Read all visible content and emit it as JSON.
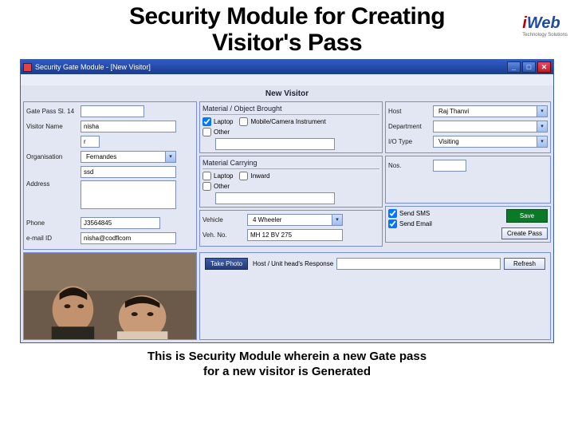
{
  "slide": {
    "title_line1": "Security Module for Creating",
    "title_line2": "Visitor's Pass",
    "caption_line1": "This is Security Module wherein a new Gate pass",
    "caption_line2": "for a new visitor is Generated",
    "logo_text": "Web",
    "logo_sub": "Technology Solutions"
  },
  "window": {
    "title": "Security Gate Module - [New Visitor]",
    "section_title": "New Visitor"
  },
  "left": {
    "gatepass_label": "Gate Pass Sl.  14",
    "gatepass_value": "",
    "visitor_name_label": "Visitor Name",
    "visitor_name_value": "nisha",
    "initial_label": "",
    "initial_value": "r",
    "organisation_label": "Organisation",
    "organisation_value": "Fernandes",
    "org_sub_value": "ssd",
    "address_label": "Address",
    "address_value": "",
    "phone_label": "Phone",
    "phone_value": "J3564845",
    "email_label": "e-mail ID",
    "email_value": "nisha@codflcom"
  },
  "mid_top": {
    "group_title": "Material / Object Brought",
    "laptop_label": "Laptop",
    "mobile_label": "Mobile/Camera Instrument",
    "other_label": "Other",
    "other_value": ""
  },
  "mid_bottom": {
    "group_title": "Material Carrying",
    "laptop_label": "Laptop",
    "other_label": "Other",
    "other_value": "",
    "inward_label": "Inward"
  },
  "mid_vehicle": {
    "vehicle_label": "Vehicle",
    "vehicle_value": "4 Wheeler",
    "vehno_label": "Veh. No.",
    "vehno_value": "MH 12 BV 275"
  },
  "right": {
    "host_label": "Host",
    "host_value": "Raj Thanvi",
    "dept_label": "Department",
    "dept_value": "",
    "iotype_label": "I/O Type",
    "iotype_value": "Visiting",
    "sendsms_label": "Send SMS",
    "sendemail_label": "Send Email",
    "nos_label": "Nos.",
    "nos_value": "",
    "save_btn": "Save",
    "create_btn": "Create Pass"
  },
  "bottom": {
    "take_photo_btn": "Take Photo",
    "host_confirm_label": "Host / Unit head's Response",
    "host_confirm_value": "",
    "refresh_btn": "Refresh"
  }
}
